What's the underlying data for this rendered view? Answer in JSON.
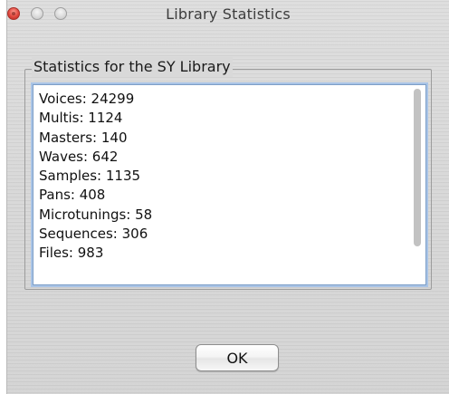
{
  "window": {
    "title": "Library Statistics"
  },
  "group": {
    "title": "Statistics for the SY Library"
  },
  "stats": {
    "lines": [
      "Voices: 24299",
      "Multis: 1124",
      "Masters: 140",
      "Waves: 642",
      "Samples: 1135",
      "Pans: 408",
      "Microtunings: 58",
      "Sequences: 306",
      "Files: 983"
    ]
  },
  "buttons": {
    "ok_label": "OK"
  },
  "colors": {
    "close_button": "#e0473d",
    "focus_ring": "#a9c4e6"
  },
  "icons": {
    "close": "close-icon",
    "minimize": "minimize-icon",
    "zoom": "zoom-icon"
  }
}
